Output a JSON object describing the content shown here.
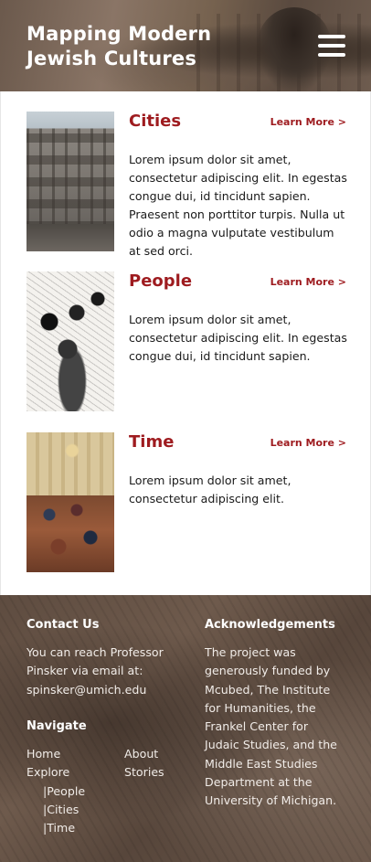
{
  "header": {
    "title_line1": "Mapping Modern",
    "title_line2": "Jewish Cultures",
    "menu_icon": "hamburger-menu-icon"
  },
  "cards": [
    {
      "title": "Cities",
      "learn_more": "Learn More >",
      "text": "Lorem ipsum dolor sit amet, consectetur adipiscing elit. In egestas congue dui, id tincidunt sapien. Praesent non porttitor turpis. Nulla ut odio a magna vulputate vestibulum at sed orci."
    },
    {
      "title": "People",
      "learn_more": "Learn More >",
      "text": "Lorem ipsum dolor sit amet, consectetur adipiscing elit. In egestas congue dui, id tincidunt sapien."
    },
    {
      "title": "Time",
      "learn_more": "Learn More >",
      "text": "Lorem ipsum dolor sit amet, consectetur adipiscing elit."
    }
  ],
  "footer": {
    "contact_heading": "Contact Us",
    "contact_text": "You can reach Professor Pinsker via email at: spinsker@umich.edu",
    "navigate_heading": "Navigate",
    "nav": {
      "home": "Home",
      "explore": "Explore",
      "people": "|People",
      "cities": "|Cities",
      "time": "|Time",
      "about": "About",
      "stories": "Stories"
    },
    "ack_heading": "Acknowledgements",
    "ack_text": "The project was generously funded by Mcubed, The Institute for Humanities, the Frankel Center for Judaic Studies, and the Middle East Studies Department at the University of Michigan."
  },
  "colors": {
    "accent": "#9e1b1f",
    "footer_bg": "#5e4c40"
  }
}
